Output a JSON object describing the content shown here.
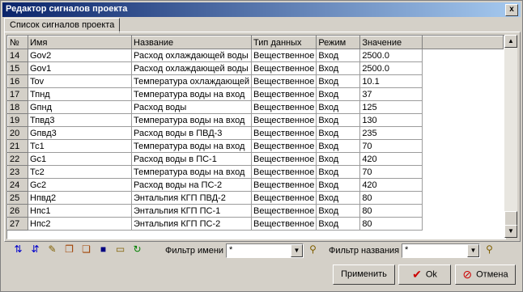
{
  "window": {
    "title": "Редактор сигналов проекта",
    "close": "x"
  },
  "tab": {
    "label": "Список сигналов проекта"
  },
  "columns": [
    "№",
    "Имя",
    "Название",
    "Тип данных",
    "Режим",
    "Значение"
  ],
  "rows": [
    [
      "14",
      "Gov2",
      "Расход охлаждающей воды",
      "Вещественное",
      "Вход",
      "2500.0"
    ],
    [
      "15",
      "Gov1",
      "Расход охлаждающей воды",
      "Вещественное",
      "Вход",
      "2500.0"
    ],
    [
      "16",
      "Tov",
      "Температура охлаждающей",
      "Вещественное",
      "Вход",
      "10.1"
    ],
    [
      "17",
      "Тпнд",
      "Температура воды на вход",
      "Вещественное",
      "Вход",
      "37"
    ],
    [
      "18",
      "Gпнд",
      "Расход воды",
      "Вещественное",
      "Вход",
      "125"
    ],
    [
      "19",
      "Тпвд3",
      "Температура воды на вход",
      "Вещественное",
      "Вход",
      "130"
    ],
    [
      "20",
      "Gпвд3",
      "Расход воды в ПВД-3",
      "Вещественное",
      "Вход",
      "235"
    ],
    [
      "21",
      "Тс1",
      "Температура воды на вход",
      "Вещественное",
      "Вход",
      "70"
    ],
    [
      "22",
      "Gc1",
      "Расход воды в ПС-1",
      "Вещественное",
      "Вход",
      "420"
    ],
    [
      "23",
      "Тс2",
      "Температура воды на вход",
      "Вещественное",
      "Вход",
      "70"
    ],
    [
      "24",
      "Gc2",
      "Расход воды на ПС-2",
      "Вещественное",
      "Вход",
      "420"
    ],
    [
      "25",
      "Нпвд2",
      "Энтальпия КГП ПВД-2",
      "Вещественное",
      "Вход",
      "80"
    ],
    [
      "26",
      "Hпс1",
      "Энтальпия КГП ПС-1",
      "Вещественное",
      "Вход",
      "80"
    ],
    [
      "27",
      "Hпс2",
      "Энтальпия КГП ПС-2",
      "Вещественное",
      "Вход",
      "80"
    ]
  ],
  "toolbar": {
    "icons": [
      "add-row-icon",
      "delete-row-icon",
      "edit-icon",
      "copy-icon",
      "paste-icon",
      "save-icon",
      "open-folder-icon",
      "refresh-icon"
    ],
    "name_filter_label": "Фильтр имени",
    "name_filter_value": "*",
    "title_filter_label": "Фильтр названия",
    "title_filter_value": "*"
  },
  "buttons": {
    "apply": "Применить",
    "ok": "Ok",
    "cancel": "Отмена"
  },
  "colors": {
    "title_start": "#0a246a",
    "title_end": "#a6caf0",
    "ok_check": "#cc0000",
    "cancel_icon": "#cc0000"
  }
}
